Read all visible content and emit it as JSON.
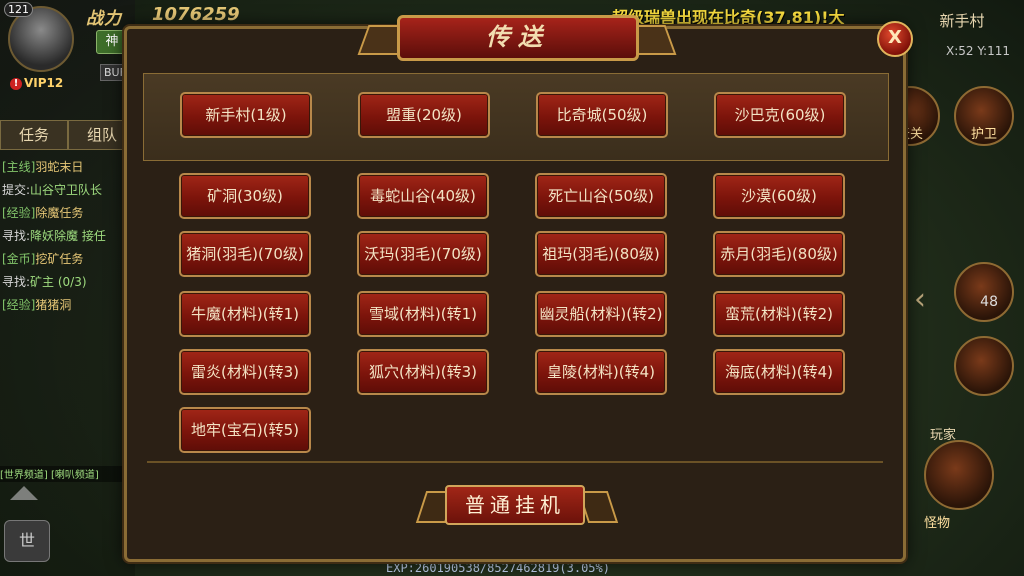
{
  "hud_left": {
    "level": "121",
    "power_label": "战力",
    "power_value": "1076259",
    "vip": "VIP12",
    "vip_warn": "!",
    "green_chip": "神",
    "buff": "BUF",
    "tabs": [
      "任务",
      "组队"
    ],
    "quests": [
      {
        "tag": "[主线]",
        "text": "羽蛇末日"
      },
      {
        "tag": "提交:",
        "text": "山谷守卫队长"
      },
      {
        "tag": "[经验]",
        "text": "除魔任务"
      },
      {
        "tag": "寻找:",
        "text": "降妖除魔 接任"
      },
      {
        "tag": "[金币]",
        "text": "挖矿任务"
      },
      {
        "tag": "寻找:",
        "text": "矿主 (0/3)"
      },
      {
        "tag": "[经验]",
        "text": "猪猪洞"
      }
    ],
    "chat_text": "[世界频道] [喇叭频道]",
    "mic_label": "世"
  },
  "announcement": "超级瑞兽出现在比奇(37,81)!大",
  "hud_right": {
    "map_name": "新手村",
    "coords": "X:52  Y:111",
    "btn_guard": "护卫",
    "btn_sky": "天关",
    "count": "48",
    "player_label": "玩家",
    "monster_label": "怪物"
  },
  "exp_text": "EXP:260190538/8527462819(3.05%)",
  "dialog": {
    "title": "传送",
    "close": "X",
    "main_destinations": [
      "新手村(1级)",
      "盟重(20级)",
      "比奇城(50级)",
      "沙巴克(60级)"
    ],
    "field_destinations": [
      [
        "矿洞(30级)",
        "毒蛇山谷(40级)",
        "死亡山谷(50级)",
        "沙漠(60级)"
      ],
      [
        "猪洞(羽毛)(70级)",
        "沃玛(羽毛)(70级)",
        "祖玛(羽毛)(80级)",
        "赤月(羽毛)(80级)"
      ],
      [
        "牛魔(材料)(转1)",
        "雪域(材料)(转1)",
        "幽灵船(材料)(转2)",
        "蛮荒(材料)(转2)"
      ],
      [
        "雷炎(材料)(转3)",
        "狐穴(材料)(转3)",
        "皇陵(材料)(转4)",
        "海底(材料)(转4)"
      ],
      [
        "地牢(宝石)(转5)"
      ]
    ],
    "hangup": "普通挂机"
  }
}
